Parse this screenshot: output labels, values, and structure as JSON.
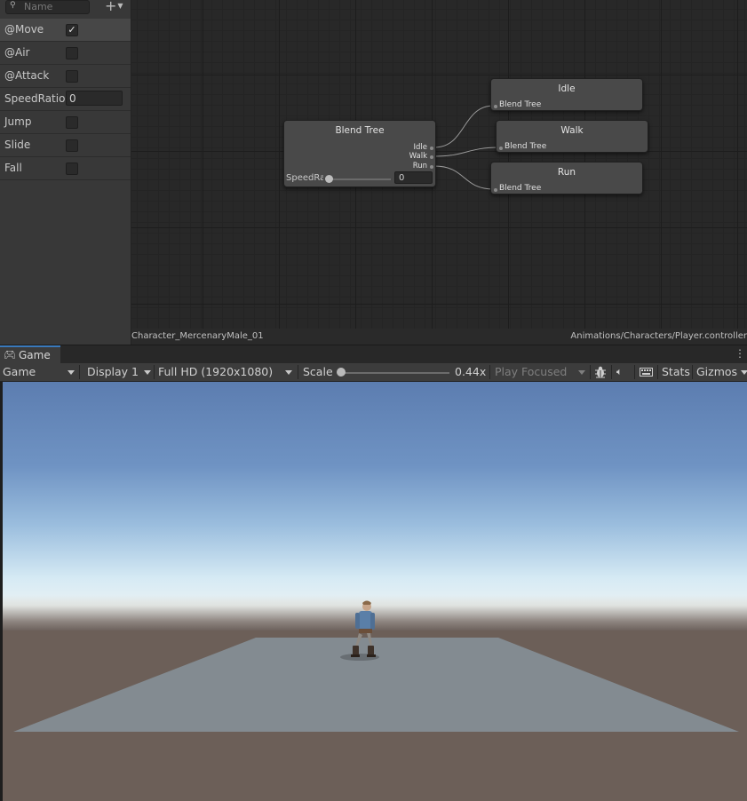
{
  "params": {
    "search_placeholder": "Name",
    "add_icon": "+",
    "items": [
      {
        "label": "@Move",
        "type": "bool",
        "checked": true,
        "mark": "✓"
      },
      {
        "label": "@Air",
        "type": "bool",
        "checked": false,
        "mark": ""
      },
      {
        "label": "@Attack",
        "type": "bool",
        "checked": false,
        "mark": ""
      },
      {
        "label": "SpeedRatio",
        "type": "float",
        "value": "0"
      },
      {
        "label": "Jump",
        "type": "trigger",
        "checked": false,
        "mark": ""
      },
      {
        "label": "Slide",
        "type": "trigger",
        "checked": false,
        "mark": ""
      },
      {
        "label": "Fall",
        "type": "trigger",
        "checked": false,
        "mark": ""
      }
    ]
  },
  "graph": {
    "blend_node": {
      "title": "Blend Tree",
      "outputs": [
        "Idle",
        "Walk",
        "Run"
      ],
      "slider_label": "SpeedRatio",
      "slider_value": "0"
    },
    "motion_nodes": [
      {
        "title": "Idle",
        "sub": "Blend Tree"
      },
      {
        "title": "Walk",
        "sub": "Blend Tree"
      },
      {
        "title": "Run",
        "sub": "Blend Tree"
      }
    ]
  },
  "status": {
    "left": "Character_MercenaryMale_01",
    "right": "Animations/Characters/Player.controller"
  },
  "game": {
    "tab_label": "Game",
    "toolbar": {
      "view": "Game",
      "display": "Display 1",
      "resolution": "Full HD (1920x1080)",
      "scale_label": "Scale",
      "scale_value": "0.44x",
      "play_mode": "Play Focused",
      "stats": "Stats",
      "gizmos": "Gizmos"
    }
  },
  "colors": {
    "accent": "#3a79bb",
    "panel": "#383838",
    "graph_bg": "#282828",
    "node": "#494949",
    "ground": "#6c5f58",
    "plane": "#838b91"
  }
}
